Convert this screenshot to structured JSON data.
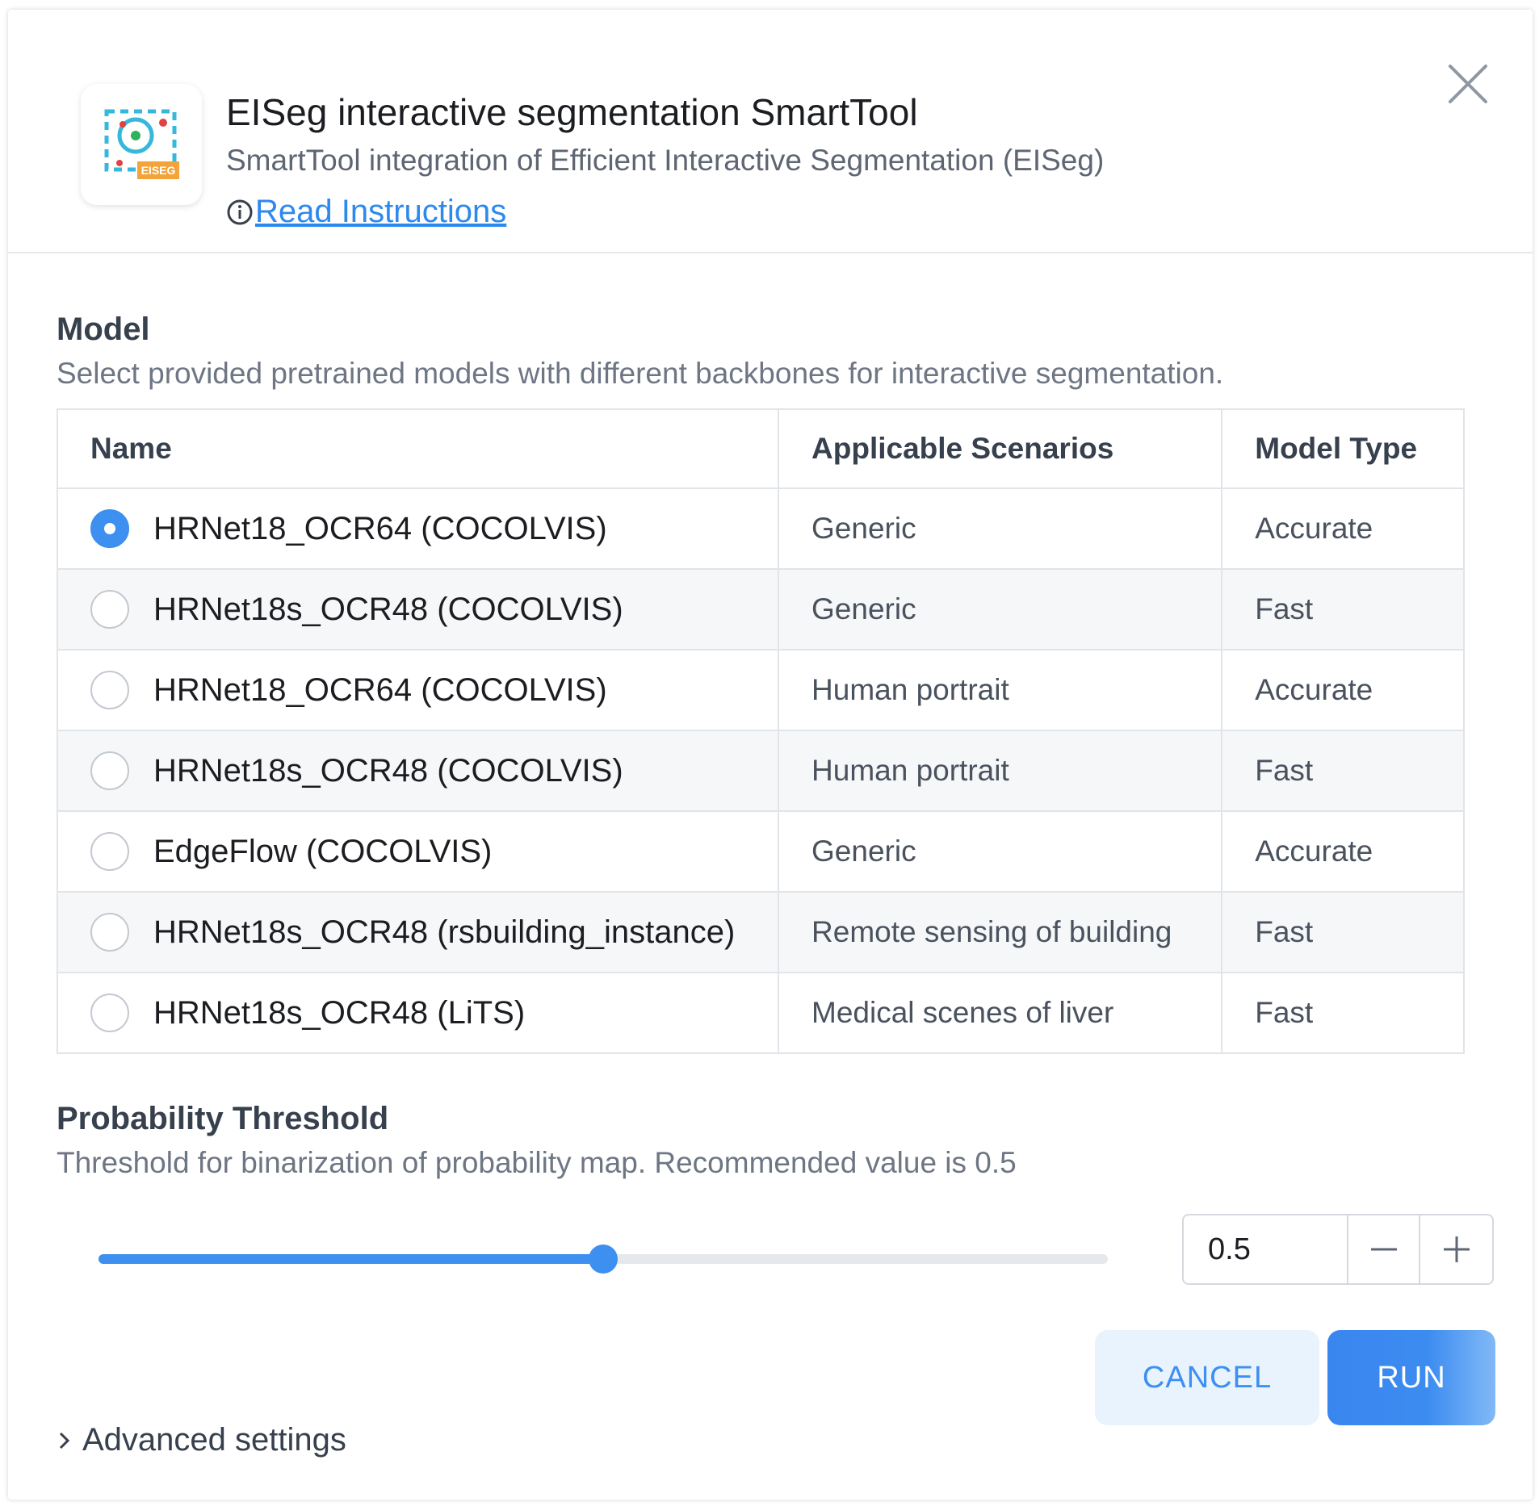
{
  "header": {
    "title": "EISeg interactive segmentation SmartTool",
    "subtitle": "SmartTool integration of Efficient Interactive Segmentation (EISeg)",
    "link_label": "Read Instructions",
    "app_icon_badge": "EISEG"
  },
  "model_section": {
    "title": "Model",
    "description": "Select provided pretrained models with different backbones for interactive segmentation.",
    "columns": [
      "Name",
      "Applicable Scenarios",
      "Model Type"
    ],
    "selected_index": 0,
    "rows": [
      {
        "name": "HRNet18_OCR64 (COCOLVIS)",
        "scenario": "Generic",
        "type": "Accurate"
      },
      {
        "name": "HRNet18s_OCR48 (COCOLVIS)",
        "scenario": "Generic",
        "type": "Fast"
      },
      {
        "name": "HRNet18_OCR64 (COCOLVIS)",
        "scenario": "Human portrait",
        "type": "Accurate"
      },
      {
        "name": "HRNet18s_OCR48 (COCOLVIS)",
        "scenario": "Human portrait",
        "type": "Fast"
      },
      {
        "name": "EdgeFlow (COCOLVIS)",
        "scenario": "Generic",
        "type": "Accurate"
      },
      {
        "name": "HRNet18s_OCR48 (rsbuilding_instance)",
        "scenario": "Remote sensing of building",
        "type": "Fast"
      },
      {
        "name": "HRNet18s_OCR48 (LiTS)",
        "scenario": "Medical scenes of liver",
        "type": "Fast"
      }
    ]
  },
  "threshold_section": {
    "title": "Probability Threshold",
    "description": "Threshold for binarization of probability map. Recommended value is 0.5",
    "value": "0.5",
    "slider_fraction": 0.5
  },
  "buttons": {
    "cancel": "CANCEL",
    "run": "RUN"
  },
  "advanced_label": "Advanced settings",
  "colors": {
    "accent": "#3d8ff0",
    "link": "#2c89ee",
    "cancel_bg": "#e8f3fd"
  }
}
